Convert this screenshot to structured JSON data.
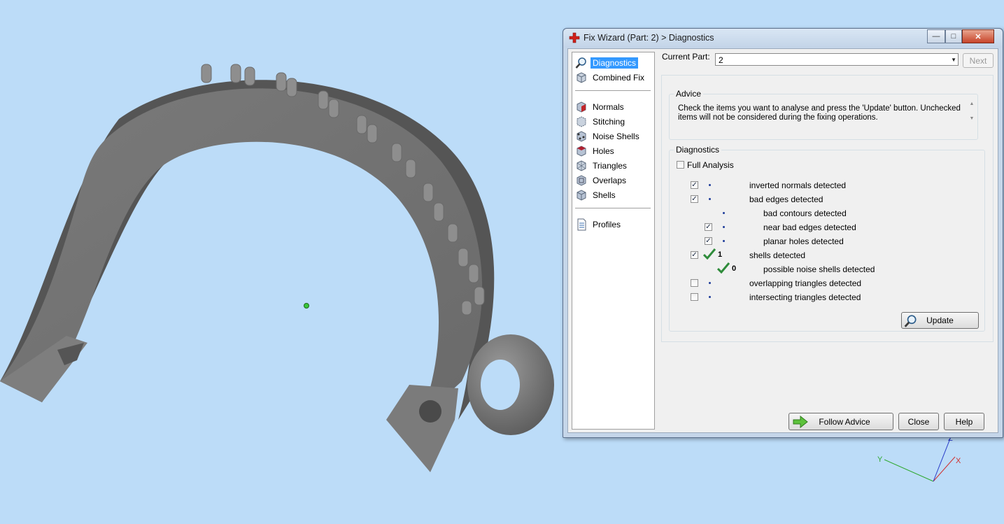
{
  "window": {
    "title": "Fix Wizard (Part: 2) > Diagnostics",
    "controls": {
      "minimize": "—",
      "maximize": "□",
      "close": "✕"
    }
  },
  "nav": {
    "items": [
      {
        "label": "Diagnostics",
        "icon": "magnifier-icon",
        "selected": true
      },
      {
        "label": "Combined Fix",
        "icon": "cube-icon"
      },
      {
        "label": "Normals",
        "icon": "normals-cube-icon"
      },
      {
        "label": "Stitching",
        "icon": "stitching-icon"
      },
      {
        "label": "Noise Shells",
        "icon": "noise-shells-icon"
      },
      {
        "label": "Holes",
        "icon": "holes-cube-icon"
      },
      {
        "label": "Triangles",
        "icon": "triangles-cube-icon"
      },
      {
        "label": "Overlaps",
        "icon": "overlaps-cube-icon"
      },
      {
        "label": "Shells",
        "icon": "shells-cube-icon"
      },
      {
        "label": "Profiles",
        "icon": "document-icon"
      }
    ]
  },
  "current_part": {
    "label": "Current Part:",
    "value": "2"
  },
  "next_button": "Next",
  "advice": {
    "title": "Advice",
    "text": "Check the items you want to analyse and press the 'Update' button. Unchecked items will not be considered during the fixing operations."
  },
  "diagnostics": {
    "title": "Diagnostics",
    "full_analysis": {
      "label": "Full Analysis",
      "checked": false
    },
    "rows": [
      {
        "label": "inverted normals detected",
        "checked": true,
        "status": "dot"
      },
      {
        "label": "bad edges detected",
        "checked": true,
        "status": "dot"
      },
      {
        "label": "bad contours detected",
        "checked": null,
        "status": "dot"
      },
      {
        "label": "near bad edges detected",
        "checked": true,
        "status": "dot"
      },
      {
        "label": "planar holes detected",
        "checked": true,
        "status": "dot"
      },
      {
        "label": "shells detected",
        "checked": true,
        "status": "ok",
        "count": "1"
      },
      {
        "label": "possible noise shells detected",
        "checked": null,
        "status": "ok",
        "count": "0"
      },
      {
        "label": "overlapping triangles detected",
        "checked": false,
        "status": "dot"
      },
      {
        "label": "intersecting triangles detected",
        "checked": false,
        "status": "dot"
      }
    ],
    "update_button": "Update"
  },
  "footer": {
    "follow_advice": "Follow Advice",
    "close": "Close",
    "help": "Help"
  },
  "axes": {
    "x": "X",
    "y": "Y",
    "z": "Z"
  },
  "colors": {
    "background": "#bcdcf8",
    "model": "#7c7c7c",
    "check_green": "#2e8b3a",
    "status_blue": "#1f3d9a"
  }
}
